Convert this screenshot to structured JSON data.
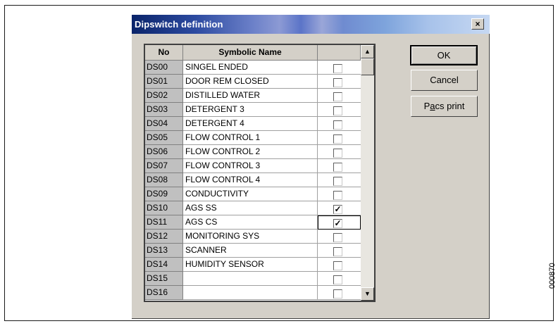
{
  "dialog": {
    "title": "Dipswitch definition",
    "close_symbol": "×"
  },
  "grid": {
    "columns": [
      "No",
      "Symbolic Name",
      ""
    ],
    "rows": [
      {
        "no": "DS00",
        "name": "SINGEL ENDED",
        "checked": false
      },
      {
        "no": "DS01",
        "name": "DOOR REM CLOSED",
        "checked": false
      },
      {
        "no": "DS02",
        "name": "DISTILLED WATER",
        "checked": false
      },
      {
        "no": "DS03",
        "name": "DETERGENT 3",
        "checked": false
      },
      {
        "no": "DS04",
        "name": "DETERGENT 4",
        "checked": false
      },
      {
        "no": "DS05",
        "name": "FLOW CONTROL 1",
        "checked": false
      },
      {
        "no": "DS06",
        "name": "FLOW CONTROL 2",
        "checked": false
      },
      {
        "no": "DS07",
        "name": "FLOW CONTROL 3",
        "checked": false
      },
      {
        "no": "DS08",
        "name": "FLOW CONTROL 4",
        "checked": false
      },
      {
        "no": "DS09",
        "name": "CONDUCTIVITY",
        "checked": false
      },
      {
        "no": "DS10",
        "name": "AGS SS",
        "checked": true
      },
      {
        "no": "DS11",
        "name": "AGS CS",
        "checked": true,
        "focused": true
      },
      {
        "no": "DS12",
        "name": "MONITORING SYS",
        "checked": false
      },
      {
        "no": "DS13",
        "name": "SCANNER",
        "checked": false
      },
      {
        "no": "DS14",
        "name": "HUMIDITY SENSOR",
        "checked": false
      },
      {
        "no": "DS15",
        "name": "",
        "checked": false
      },
      {
        "no": "DS16",
        "name": "",
        "checked": false
      }
    ],
    "scroll_up_icon": "▲",
    "scroll_down_icon": "▼",
    "check_mark": "✓"
  },
  "buttons": {
    "ok": "OK",
    "cancel": "Cancel",
    "pacs_print_prefix": "P",
    "pacs_print_underlined": "a",
    "pacs_print_rest": "cs print"
  },
  "figure_code": "000870"
}
